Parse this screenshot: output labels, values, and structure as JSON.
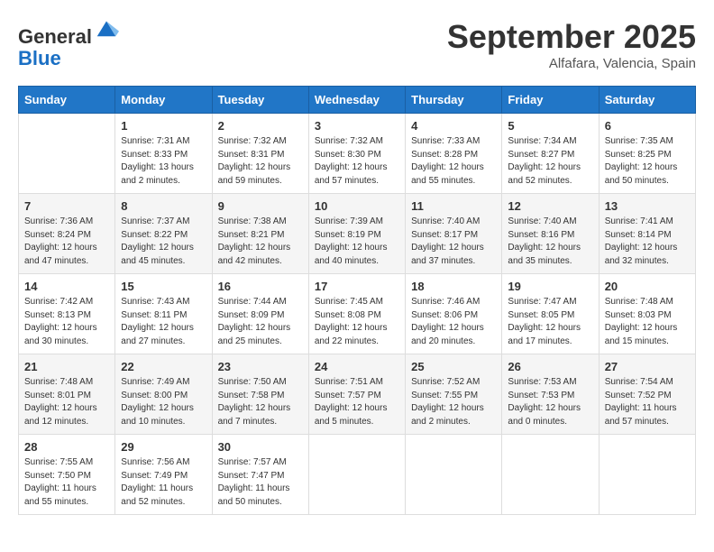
{
  "header": {
    "logo_line1": "General",
    "logo_line2": "Blue",
    "month_title": "September 2025",
    "location": "Alfafara, Valencia, Spain"
  },
  "days_of_week": [
    "Sunday",
    "Monday",
    "Tuesday",
    "Wednesday",
    "Thursday",
    "Friday",
    "Saturday"
  ],
  "weeks": [
    [
      {
        "day": "",
        "info": ""
      },
      {
        "day": "1",
        "info": "Sunrise: 7:31 AM\nSunset: 8:33 PM\nDaylight: 13 hours\nand 2 minutes."
      },
      {
        "day": "2",
        "info": "Sunrise: 7:32 AM\nSunset: 8:31 PM\nDaylight: 12 hours\nand 59 minutes."
      },
      {
        "day": "3",
        "info": "Sunrise: 7:32 AM\nSunset: 8:30 PM\nDaylight: 12 hours\nand 57 minutes."
      },
      {
        "day": "4",
        "info": "Sunrise: 7:33 AM\nSunset: 8:28 PM\nDaylight: 12 hours\nand 55 minutes."
      },
      {
        "day": "5",
        "info": "Sunrise: 7:34 AM\nSunset: 8:27 PM\nDaylight: 12 hours\nand 52 minutes."
      },
      {
        "day": "6",
        "info": "Sunrise: 7:35 AM\nSunset: 8:25 PM\nDaylight: 12 hours\nand 50 minutes."
      }
    ],
    [
      {
        "day": "7",
        "info": "Sunrise: 7:36 AM\nSunset: 8:24 PM\nDaylight: 12 hours\nand 47 minutes."
      },
      {
        "day": "8",
        "info": "Sunrise: 7:37 AM\nSunset: 8:22 PM\nDaylight: 12 hours\nand 45 minutes."
      },
      {
        "day": "9",
        "info": "Sunrise: 7:38 AM\nSunset: 8:21 PM\nDaylight: 12 hours\nand 42 minutes."
      },
      {
        "day": "10",
        "info": "Sunrise: 7:39 AM\nSunset: 8:19 PM\nDaylight: 12 hours\nand 40 minutes."
      },
      {
        "day": "11",
        "info": "Sunrise: 7:40 AM\nSunset: 8:17 PM\nDaylight: 12 hours\nand 37 minutes."
      },
      {
        "day": "12",
        "info": "Sunrise: 7:40 AM\nSunset: 8:16 PM\nDaylight: 12 hours\nand 35 minutes."
      },
      {
        "day": "13",
        "info": "Sunrise: 7:41 AM\nSunset: 8:14 PM\nDaylight: 12 hours\nand 32 minutes."
      }
    ],
    [
      {
        "day": "14",
        "info": "Sunrise: 7:42 AM\nSunset: 8:13 PM\nDaylight: 12 hours\nand 30 minutes."
      },
      {
        "day": "15",
        "info": "Sunrise: 7:43 AM\nSunset: 8:11 PM\nDaylight: 12 hours\nand 27 minutes."
      },
      {
        "day": "16",
        "info": "Sunrise: 7:44 AM\nSunset: 8:09 PM\nDaylight: 12 hours\nand 25 minutes."
      },
      {
        "day": "17",
        "info": "Sunrise: 7:45 AM\nSunset: 8:08 PM\nDaylight: 12 hours\nand 22 minutes."
      },
      {
        "day": "18",
        "info": "Sunrise: 7:46 AM\nSunset: 8:06 PM\nDaylight: 12 hours\nand 20 minutes."
      },
      {
        "day": "19",
        "info": "Sunrise: 7:47 AM\nSunset: 8:05 PM\nDaylight: 12 hours\nand 17 minutes."
      },
      {
        "day": "20",
        "info": "Sunrise: 7:48 AM\nSunset: 8:03 PM\nDaylight: 12 hours\nand 15 minutes."
      }
    ],
    [
      {
        "day": "21",
        "info": "Sunrise: 7:48 AM\nSunset: 8:01 PM\nDaylight: 12 hours\nand 12 minutes."
      },
      {
        "day": "22",
        "info": "Sunrise: 7:49 AM\nSunset: 8:00 PM\nDaylight: 12 hours\nand 10 minutes."
      },
      {
        "day": "23",
        "info": "Sunrise: 7:50 AM\nSunset: 7:58 PM\nDaylight: 12 hours\nand 7 minutes."
      },
      {
        "day": "24",
        "info": "Sunrise: 7:51 AM\nSunset: 7:57 PM\nDaylight: 12 hours\nand 5 minutes."
      },
      {
        "day": "25",
        "info": "Sunrise: 7:52 AM\nSunset: 7:55 PM\nDaylight: 12 hours\nand 2 minutes."
      },
      {
        "day": "26",
        "info": "Sunrise: 7:53 AM\nSunset: 7:53 PM\nDaylight: 12 hours\nand 0 minutes."
      },
      {
        "day": "27",
        "info": "Sunrise: 7:54 AM\nSunset: 7:52 PM\nDaylight: 11 hours\nand 57 minutes."
      }
    ],
    [
      {
        "day": "28",
        "info": "Sunrise: 7:55 AM\nSunset: 7:50 PM\nDaylight: 11 hours\nand 55 minutes."
      },
      {
        "day": "29",
        "info": "Sunrise: 7:56 AM\nSunset: 7:49 PM\nDaylight: 11 hours\nand 52 minutes."
      },
      {
        "day": "30",
        "info": "Sunrise: 7:57 AM\nSunset: 7:47 PM\nDaylight: 11 hours\nand 50 minutes."
      },
      {
        "day": "",
        "info": ""
      },
      {
        "day": "",
        "info": ""
      },
      {
        "day": "",
        "info": ""
      },
      {
        "day": "",
        "info": ""
      }
    ]
  ]
}
